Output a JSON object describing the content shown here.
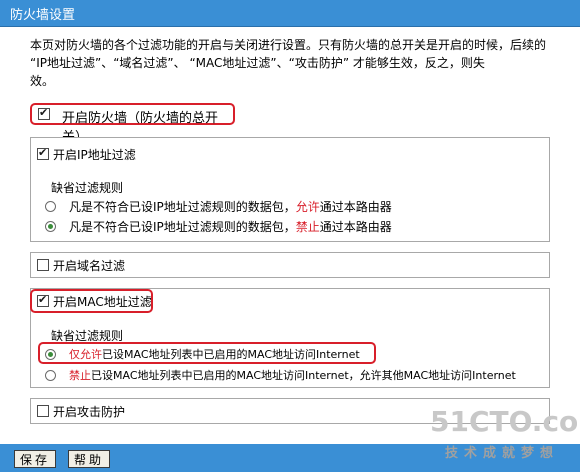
{
  "window": {
    "title": "防火墙设置"
  },
  "description": {
    "line1": "本页对防火墙的各个过滤功能的开启与关闭进行设置。只有防火墙的总开关是开启的时候，后续的",
    "line2": "“IP地址过滤”、“域名过滤”、 “MAC地址过滤”、“攻击防护” 才能够生效，反之，则失",
    "line3": "效。"
  },
  "master_switch": {
    "label": "开启防火墙（防火墙的总开关）",
    "checked": true
  },
  "ip_filter": {
    "label": "开启IP地址过滤",
    "checked": true,
    "rule_title": "缺省过滤规则",
    "option1_pre": "凡是不符合已设IP地址过滤规则的数据包，",
    "option1_key": "允许",
    "option1_post": "通过本路由器",
    "option2_pre": "凡是不符合已设IP地址过滤规则的数据包，",
    "option2_key": "禁止",
    "option2_post": "通过本路由器",
    "selected": 2
  },
  "domain_filter": {
    "label": "开启域名过滤",
    "checked": false
  },
  "mac_filter": {
    "label": "开启MAC地址过滤",
    "checked": true,
    "rule_title": "缺省过滤规则",
    "option1_key": "仅允许",
    "option1_post": "已设MAC地址列表中已启用的MAC地址访问Internet",
    "option2_key": "禁止",
    "option2_post": "已设MAC地址列表中已启用的MAC地址访问Internet，允许其他MAC地址访问Internet",
    "selected": 1
  },
  "attack_protection": {
    "label": "开启攻击防护",
    "checked": false
  },
  "buttons": {
    "save": "保存",
    "help": "帮助"
  },
  "watermark": {
    "brand": "51CTO.com",
    "slogan": "技术成就梦想"
  },
  "colors": {
    "titlebar": "#3a8fd5",
    "highlight": "#d81f2a"
  }
}
